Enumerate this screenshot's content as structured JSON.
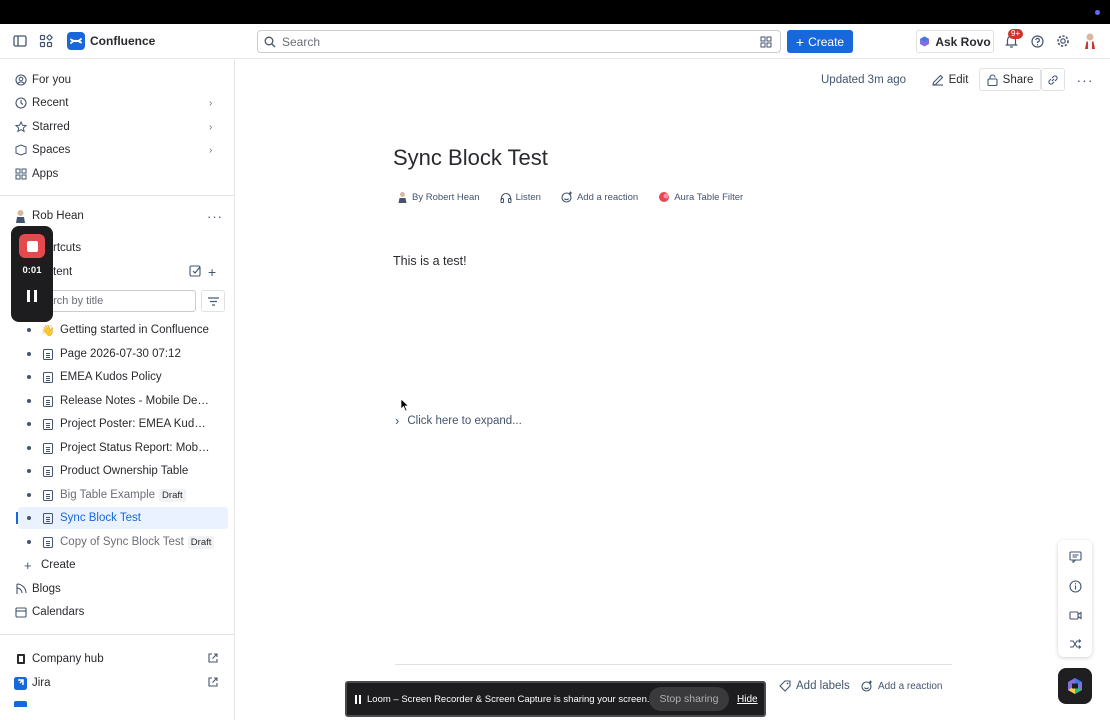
{
  "app": {
    "name": "Confluence"
  },
  "header": {
    "search_placeholder": "Search",
    "create_label": "Create",
    "rovo_label": "Ask Rovo",
    "notifications_badge": "9+"
  },
  "sidebar": {
    "nav": [
      {
        "label": "For you"
      },
      {
        "label": "Recent"
      },
      {
        "label": "Starred"
      },
      {
        "label": "Spaces"
      },
      {
        "label": "Apps"
      }
    ],
    "space_owner": "Rob Hean",
    "shortcuts_label": "rtcuts",
    "content_label": "tent",
    "filter_placeholder": "arch by title",
    "tree": [
      {
        "label": "Getting started in Confluence",
        "emoji": "👋"
      },
      {
        "label": "Page 2026-07-30 07:12"
      },
      {
        "label": "EMEA Kudos Policy"
      },
      {
        "label": "Release Notes - Mobile Dev (..."
      },
      {
        "label": "Project Poster: EMEA Kudos ..."
      },
      {
        "label": "Project Status Report: Mobile..."
      },
      {
        "label": "Product Ownership Table"
      },
      {
        "label": "Big Table Example",
        "badge": "Draft"
      },
      {
        "label": "Sync Block Test"
      },
      {
        "label": "Copy of Sync Block Test",
        "badge": "Draft"
      }
    ],
    "create_label": "Create",
    "blogs_label": "Blogs",
    "calendars_label": "Calendars",
    "apps_links": [
      {
        "label": "Company hub"
      },
      {
        "label": "Jira"
      }
    ]
  },
  "loom": {
    "timer": "0:01",
    "share_message": "Loom – Screen Recorder & Screen Capture is sharing your screen.",
    "stop_label": "Stop sharing",
    "hide_label": "Hide"
  },
  "page": {
    "updated": "Updated 3m ago",
    "edit_label": "Edit",
    "share_label": "Share",
    "title": "Sync Block Test",
    "byline": {
      "author": "By Robert Hean",
      "listen": "Listen",
      "reaction": "Add a reaction",
      "app": "Aura Table Filter"
    },
    "body": "This is a test!",
    "expand_label": "Click here to expand...",
    "footer": {
      "labels": "Add labels",
      "reaction": "Add a reaction"
    }
  },
  "colors": {
    "brand": "#1868db",
    "record": "#e5484d",
    "badge": "#c9372c"
  }
}
